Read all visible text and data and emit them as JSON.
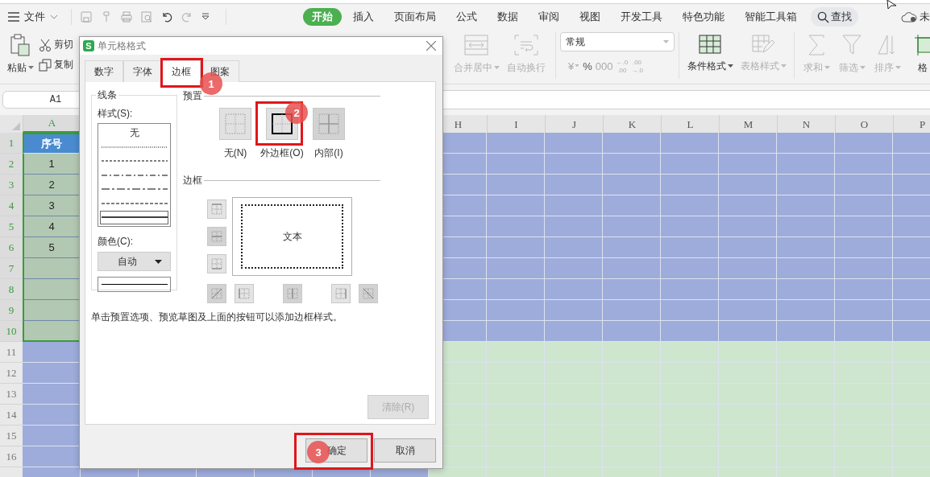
{
  "menu_bar": {
    "file_menu": "文件",
    "tabs": [
      {
        "label": "开始",
        "selected": true
      },
      {
        "label": "插入",
        "selected": false
      },
      {
        "label": "页面布局",
        "selected": false
      },
      {
        "label": "公式",
        "selected": false
      },
      {
        "label": "数据",
        "selected": false
      },
      {
        "label": "审阅",
        "selected": false
      },
      {
        "label": "视图",
        "selected": false
      },
      {
        "label": "开发工具",
        "selected": false
      },
      {
        "label": "特色功能",
        "selected": false
      },
      {
        "label": "智能工具箱",
        "selected": false
      }
    ],
    "search": "查找",
    "sync_status": "未"
  },
  "ribbon": {
    "paste": "粘贴",
    "cut": "剪切",
    "copy": "复制",
    "align_buttons": [
      {
        "kind": "merge",
        "label": "合并居中",
        "disabled": true,
        "dropdown": true
      },
      {
        "kind": "wrap",
        "label": "自动换行",
        "disabled": true,
        "dropdown": false
      }
    ],
    "number_format": "常规",
    "number_buttons": [
      {
        "lines": [
          "¥"
        ],
        "disabled": true,
        "dropdown": true
      },
      {
        "lines": [
          "%"
        ],
        "disabled": false,
        "dropdown": false
      },
      {
        "lines": [
          "000"
        ],
        "disabled": true,
        "dropdown": false
      },
      {
        "lines": [
          "←.0",
          ".00"
        ],
        "disabled": true,
        "dropdown": false
      },
      {
        "lines": [
          ".00",
          "→.0"
        ],
        "disabled": true,
        "dropdown": false
      }
    ],
    "style_buttons": [
      {
        "kind": "conditional",
        "label": "条件格式",
        "disabled": false,
        "dropdown": true
      },
      {
        "kind": "table",
        "label": "表格样式",
        "disabled": true,
        "dropdown": true
      }
    ],
    "edit_buttons": [
      {
        "kind": "sum",
        "label": "求和",
        "disabled": true,
        "dropdown": true
      },
      {
        "kind": "filter",
        "label": "筛选",
        "disabled": true,
        "dropdown": true
      },
      {
        "kind": "sort",
        "label": "排序",
        "disabled": true,
        "dropdown": true
      },
      {
        "kind": "format",
        "label": "格",
        "disabled": false,
        "dropdown": false
      }
    ]
  },
  "formula_bar": {
    "name_box": "A1"
  },
  "sheet": {
    "columns_left": [
      {
        "label": "A",
        "selected": true
      }
    ],
    "columns_right": [
      {
        "label": "H",
        "selected": false
      },
      {
        "label": "I",
        "selected": false
      },
      {
        "label": "J",
        "selected": false
      },
      {
        "label": "K",
        "selected": false
      },
      {
        "label": "L",
        "selected": false
      },
      {
        "label": "M",
        "selected": false
      },
      {
        "label": "N",
        "selected": false
      },
      {
        "label": "O",
        "selected": false
      },
      {
        "label": "P",
        "selected": false
      }
    ],
    "left_fill": {
      "color": "#9eacdb"
    },
    "rows": [
      {
        "label": "1",
        "selected": true,
        "color": "#9eacdb",
        "cell_a": {
          "text": "序号",
          "kind": "header"
        }
      },
      {
        "label": "2",
        "selected": true,
        "color": "#9eacdb",
        "cell_a": {
          "text": "1",
          "kind": "value"
        }
      },
      {
        "label": "3",
        "selected": true,
        "color": "#9eacdb",
        "cell_a": {
          "text": "2",
          "kind": "value"
        }
      },
      {
        "label": "4",
        "selected": true,
        "color": "#9eacdb",
        "cell_a": {
          "text": "3",
          "kind": "value"
        }
      },
      {
        "label": "5",
        "selected": true,
        "color": "#9eacdb",
        "cell_a": {
          "text": "4",
          "kind": "value"
        }
      },
      {
        "label": "6",
        "selected": true,
        "color": "#9eacdb",
        "cell_a": {
          "text": "5",
          "kind": "value"
        }
      },
      {
        "label": "7",
        "selected": true,
        "color": "#9eacdb"
      },
      {
        "label": "8",
        "selected": true,
        "color": "#9eacdb"
      },
      {
        "label": "9",
        "selected": true,
        "color": "#9eacdb"
      },
      {
        "label": "10",
        "selected": true,
        "color": "#9eacdb"
      },
      {
        "label": "11",
        "selected": false,
        "color": "#cde6cd"
      },
      {
        "label": "12",
        "selected": false,
        "color": "#cde6cd"
      },
      {
        "label": "13",
        "selected": false,
        "color": "#cde6cd"
      },
      {
        "label": "14",
        "selected": false,
        "color": "#cde6cd"
      },
      {
        "label": "15",
        "selected": false,
        "color": "#cde6cd"
      },
      {
        "label": "16",
        "selected": false,
        "color": "#cde6cd"
      },
      {
        "selected": false,
        "color": "#cde6cd"
      }
    ]
  },
  "dialog": {
    "icon_label": "S",
    "title": "单元格格式",
    "tabs": [
      {
        "label": "数字",
        "selected": false
      },
      {
        "label": "字体",
        "selected": false
      },
      {
        "label": "边框",
        "selected": true
      },
      {
        "label": "图案",
        "selected": false
      }
    ],
    "line_group": {
      "title": "线条",
      "style_label": "样式(S):",
      "styles": [
        {
          "kind": "none",
          "label": "无",
          "selected": false
        },
        {
          "kind": "dotted",
          "selected": false
        },
        {
          "kind": "dashed-fine",
          "selected": false
        },
        {
          "kind": "dash-dot",
          "selected": false
        },
        {
          "kind": "dash-dot-long",
          "selected": false
        },
        {
          "kind": "dashed",
          "selected": false
        },
        {
          "kind": "solid",
          "selected": true
        }
      ],
      "color_label": "颜色(C):",
      "color_value": "自动"
    },
    "presets": {
      "title": "预置",
      "items": [
        {
          "kind": "none",
          "label": "无(N)",
          "disabled": false
        },
        {
          "kind": "outline",
          "label": "外边框(O)",
          "disabled": false
        },
        {
          "kind": "inside",
          "label": "内部(I)",
          "disabled": true
        }
      ]
    },
    "border": {
      "title": "边框",
      "preview_text": "文本",
      "side_buttons": [
        {
          "kind": "top",
          "disabled": false
        },
        {
          "kind": "middle",
          "disabled": true
        },
        {
          "kind": "bottom",
          "disabled": false
        }
      ],
      "bottom_buttons": [
        {
          "kind": "diag-up",
          "disabled": true
        },
        {
          "kind": "left",
          "disabled": false
        },
        {
          "kind": "center",
          "disabled": true
        },
        {
          "kind": "right",
          "disabled": false
        },
        {
          "kind": "diag-down",
          "disabled": true
        }
      ]
    },
    "hint": "单击预置选项、预览草图及上面的按钮可以添加边框样式。",
    "clear_button": {
      "label": "清除(R)",
      "disabled": true
    },
    "ok": "确定",
    "cancel": "取消"
  },
  "annotations": [
    {
      "label": "1"
    },
    {
      "label": "2"
    },
    {
      "label": "3"
    }
  ]
}
